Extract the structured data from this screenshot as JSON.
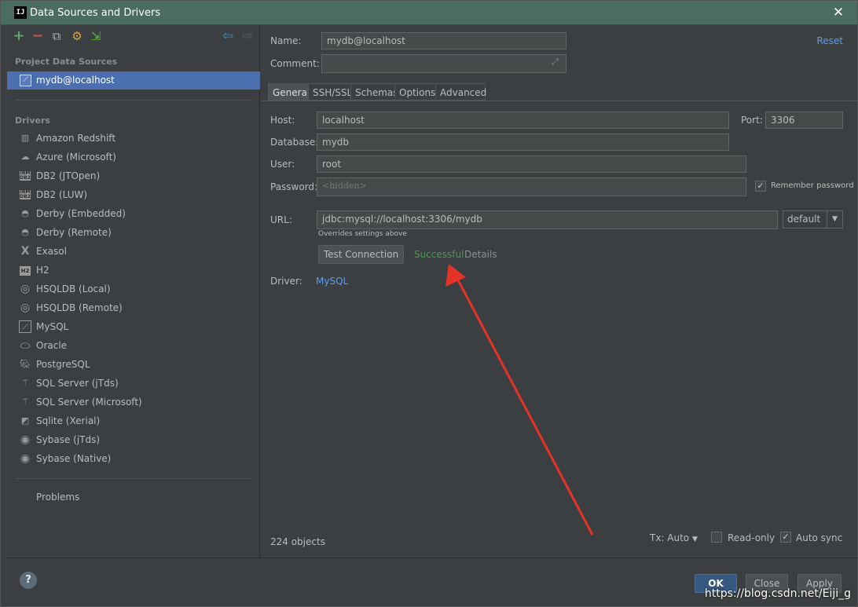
{
  "window": {
    "app_icon_text": "IJ",
    "title": "Data Sources and Drivers",
    "close_glyph": "✕"
  },
  "sidebar": {
    "toolbar": {
      "add": "+",
      "remove": "−",
      "copy": "⧉",
      "settings": "⚙",
      "import": "⇲",
      "back": "⇦",
      "forward": "⇨"
    },
    "project_header": "Project Data Sources",
    "project_item": "mydb@localhost",
    "drivers_header": "Drivers",
    "drivers": [
      {
        "label": "Amazon Redshift",
        "icon": "redshift-icon"
      },
      {
        "label": "Azure (Microsoft)",
        "icon": "azure-icon"
      },
      {
        "label": "DB2 (JTOpen)",
        "icon": "db2-icon"
      },
      {
        "label": "DB2 (LUW)",
        "icon": "db2-icon"
      },
      {
        "label": "Derby (Embedded)",
        "icon": "derby-icon"
      },
      {
        "label": "Derby (Remote)",
        "icon": "derby-icon"
      },
      {
        "label": "Exasol",
        "icon": "exasol-icon"
      },
      {
        "label": "H2",
        "icon": "h2-icon"
      },
      {
        "label": "HSQLDB (Local)",
        "icon": "hsqldb-icon"
      },
      {
        "label": "HSQLDB (Remote)",
        "icon": "hsqldb-icon"
      },
      {
        "label": "MySQL",
        "icon": "mysql-icon"
      },
      {
        "label": "Oracle",
        "icon": "oracle-icon"
      },
      {
        "label": "PostgreSQL",
        "icon": "postgresql-icon"
      },
      {
        "label": "SQL Server (jTds)",
        "icon": "sqlserver-icon"
      },
      {
        "label": "SQL Server (Microsoft)",
        "icon": "sqlserver-icon"
      },
      {
        "label": "Sqlite (Xerial)",
        "icon": "sqlite-icon"
      },
      {
        "label": "Sybase (jTds)",
        "icon": "sybase-icon"
      },
      {
        "label": "Sybase (Native)",
        "icon": "sybase-icon"
      }
    ],
    "problems": "Problems"
  },
  "form": {
    "name_label": "Name:",
    "name_value": "mydb@localhost",
    "comment_label": "Comment:",
    "comment_value": "",
    "reset": "Reset",
    "tabs": [
      "General",
      "SSH/SSL",
      "Schemas",
      "Options",
      "Advanced"
    ],
    "host_label": "Host:",
    "host_value": "localhost",
    "port_label": "Port:",
    "port_value": "3306",
    "database_label": "Database:",
    "database_value": "mydb",
    "user_label": "User:",
    "user_value": "root",
    "password_label": "Password:",
    "password_placeholder": "<hidden>",
    "remember_password": "Remember password",
    "url_label": "URL:",
    "url_value": "jdbc:mysql://localhost:3306/mydb",
    "url_mode": "default",
    "url_hint": "Overrides settings above",
    "test_connection": "Test Connection",
    "test_status": "Successful",
    "details": "Details",
    "driver_label": "Driver:",
    "driver_value": "MySQL",
    "objects_count": "224 objects",
    "tx_mode": "Tx: Auto",
    "read_only": "Read-only",
    "auto_sync": "Auto sync"
  },
  "footer": {
    "help": "?",
    "ok": "OK",
    "close": "Close",
    "apply": "Apply",
    "watermark": "https://blog.csdn.net/Eiji_g"
  },
  "colors": {
    "success": "#499c54",
    "link": "#589df6",
    "selection": "#4b6eaf",
    "annotation_arrow": "#e5332a"
  }
}
